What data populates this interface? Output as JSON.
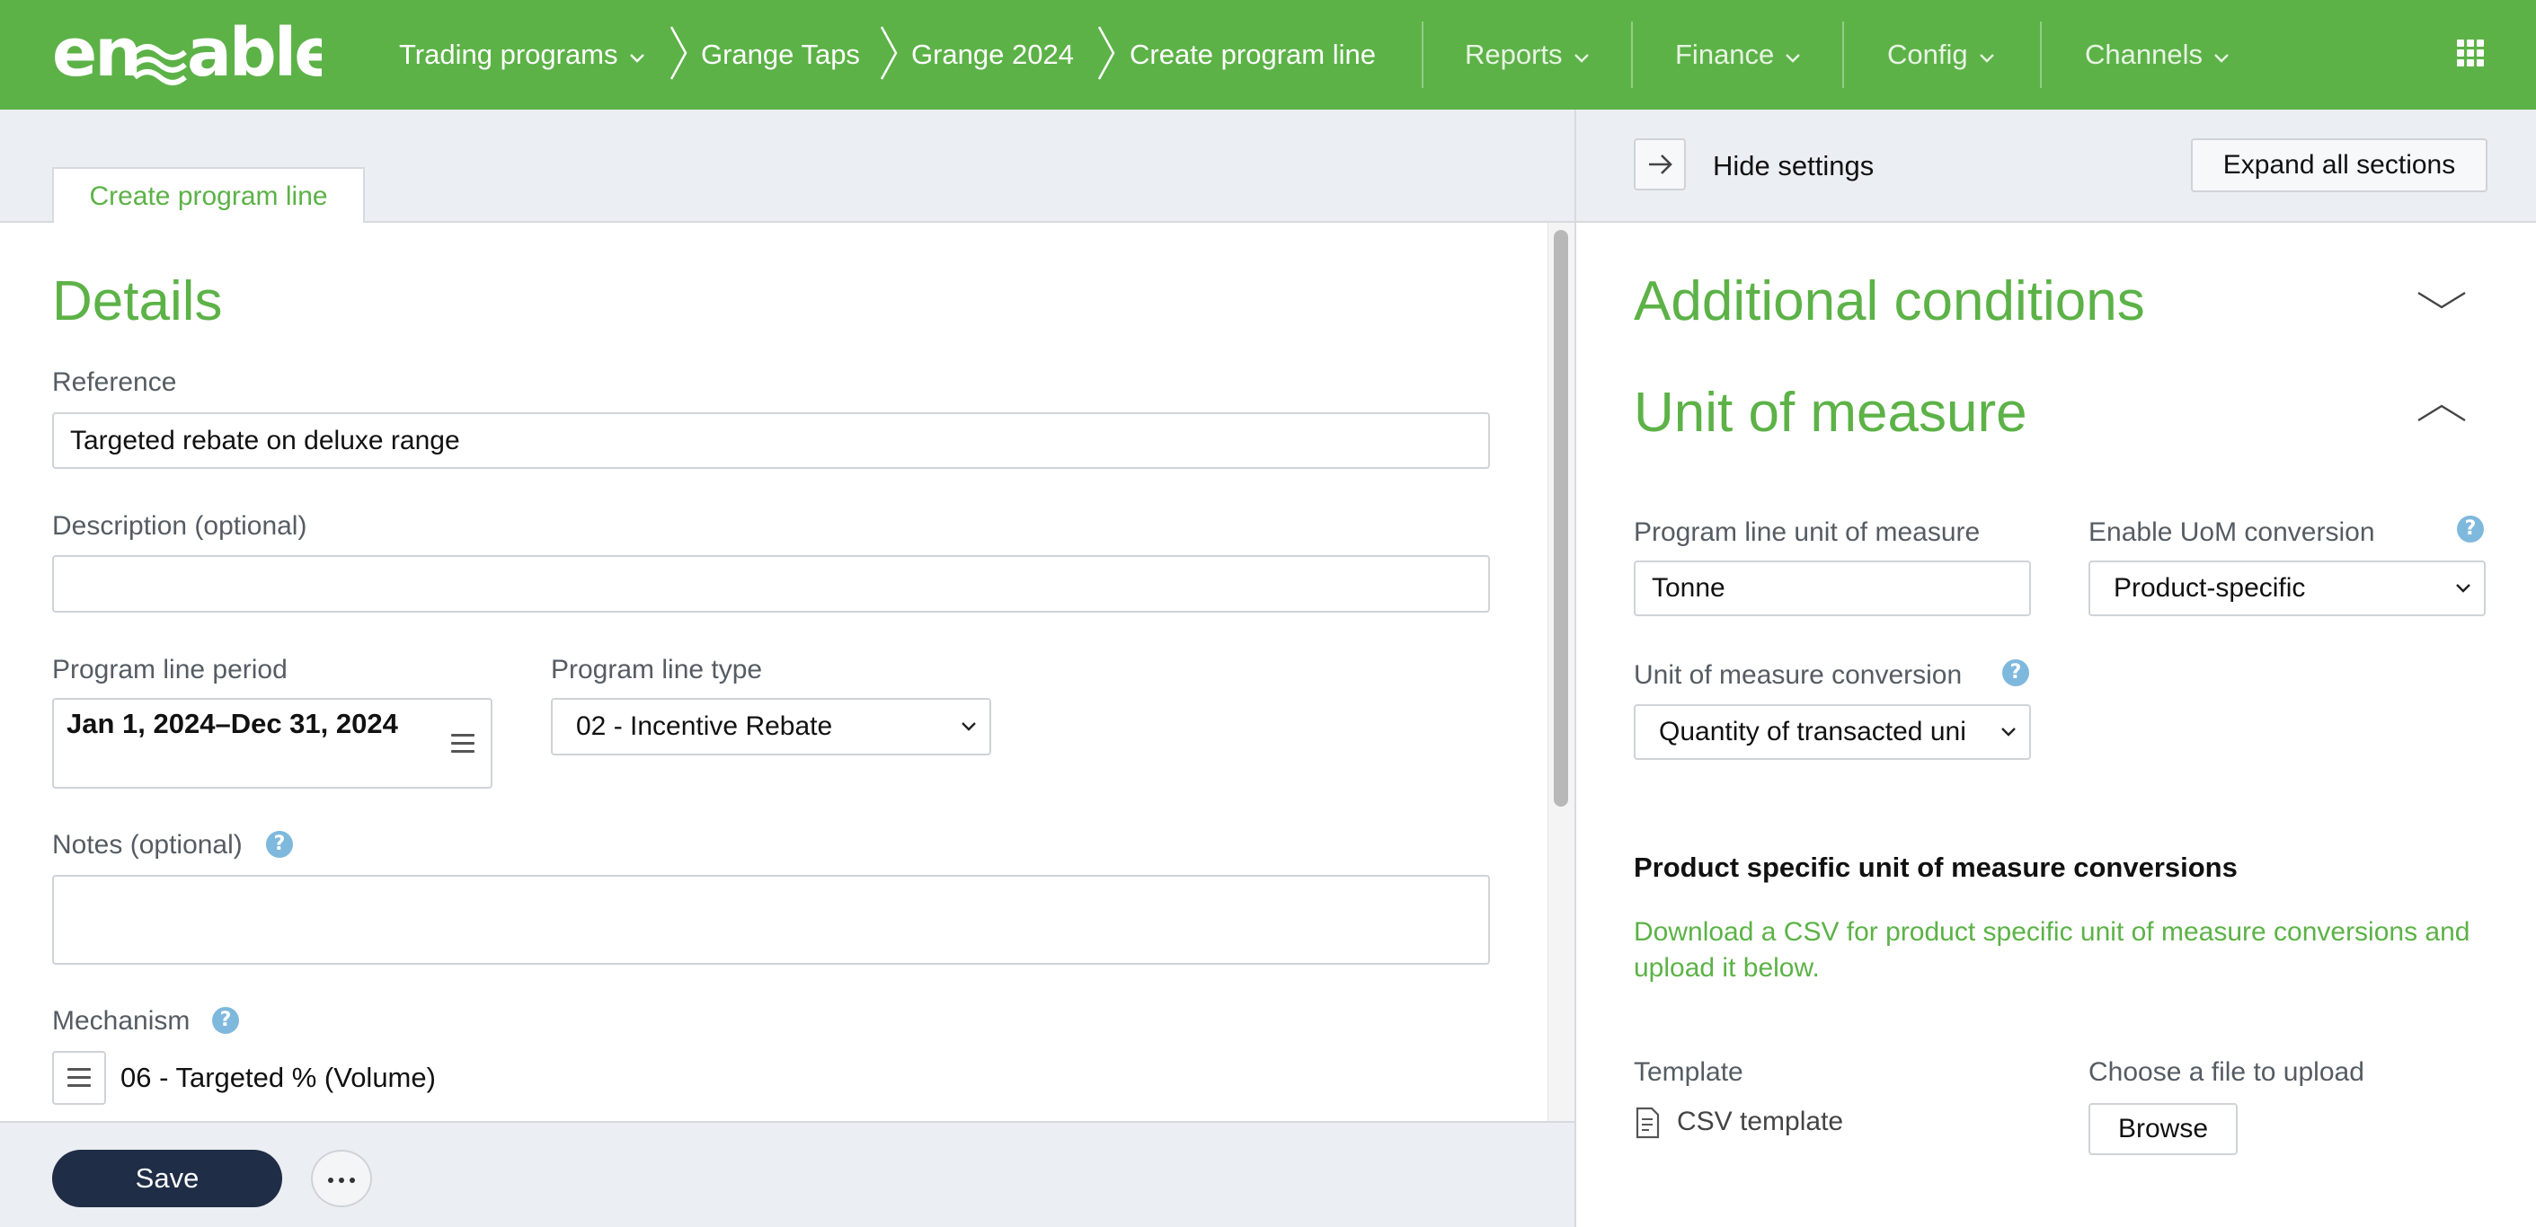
{
  "app": {
    "logo_text": "enable",
    "brand_color": "#5cb247",
    "dark_button_color": "#1f2d46"
  },
  "breadcrumb": {
    "trading_programs": "Trading programs",
    "grange_taps": "Grange Taps",
    "grange_2024": "Grange 2024",
    "current": "Create program line"
  },
  "nav": {
    "reports": "Reports",
    "finance": "Finance",
    "config": "Config",
    "channels": "Channels"
  },
  "tab": {
    "label": "Create program line"
  },
  "details": {
    "title": "Details",
    "reference_label": "Reference",
    "reference_value": "Targeted rebate on deluxe range",
    "description_label": "Description (optional)",
    "description_value": "",
    "period_label": "Program line period",
    "period_value": "Jan 1, 2024–Dec 31, 2024",
    "type_label": "Program line type",
    "type_value": "02 - Incentive Rebate",
    "notes_label": "Notes (optional)",
    "notes_value": "",
    "mechanism_label": "Mechanism",
    "mechanism_value": "06 - Targeted % (Volume)"
  },
  "footer": {
    "save_label": "Save"
  },
  "settings": {
    "hide_label": "Hide settings",
    "expand_label": "Expand all sections",
    "additional_conditions_title": "Additional conditions",
    "uom_title": "Unit of measure",
    "program_line_uom_label": "Program line unit of measure",
    "program_line_uom_value": "Tonne",
    "enable_uom_label": "Enable UoM conversion",
    "enable_uom_value": "Product-specific",
    "uom_conversion_label": "Unit of measure conversion",
    "uom_conversion_value": "Quantity of transacted uni",
    "product_specific_heading": "Product specific unit of measure conversions",
    "download_text": "Download a CSV for product specific unit of measure conversions and upload it below.",
    "template_label": "Template",
    "csv_template_label": "CSV template",
    "choose_file_label": "Choose a file to upload",
    "browse_label": "Browse"
  }
}
